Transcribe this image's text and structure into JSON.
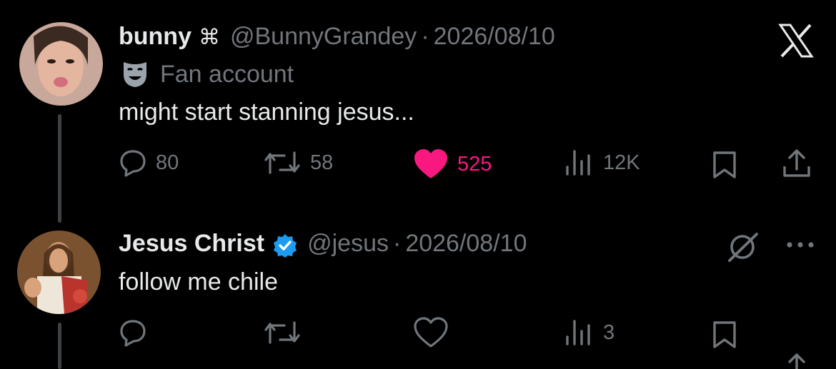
{
  "colors": {
    "background": "#000000",
    "text": "#e7e9ea",
    "muted": "#71767b",
    "like": "#f91880",
    "verified": "#1d9bf0"
  },
  "tweet1": {
    "display_name": "bunny",
    "name_symbol": "⌘",
    "handle": "@BunnyGrandey",
    "date": "2026/08/10",
    "label": "Fan account",
    "text": "might start stanning jesus...",
    "replies": "80",
    "reposts": "58",
    "likes": "525",
    "views": "12K"
  },
  "tweet2": {
    "display_name": "Jesus Christ",
    "handle": "@jesus",
    "date": "2026/08/10",
    "text": "follow me chile",
    "views": "3"
  },
  "icons": [
    "x-logo-icon",
    "theater-mask-icon",
    "reply-icon",
    "repost-icon",
    "like-icon",
    "views-icon",
    "bookmark-icon",
    "share-icon",
    "verified-badge-icon",
    "grok-icon",
    "more-icon"
  ]
}
